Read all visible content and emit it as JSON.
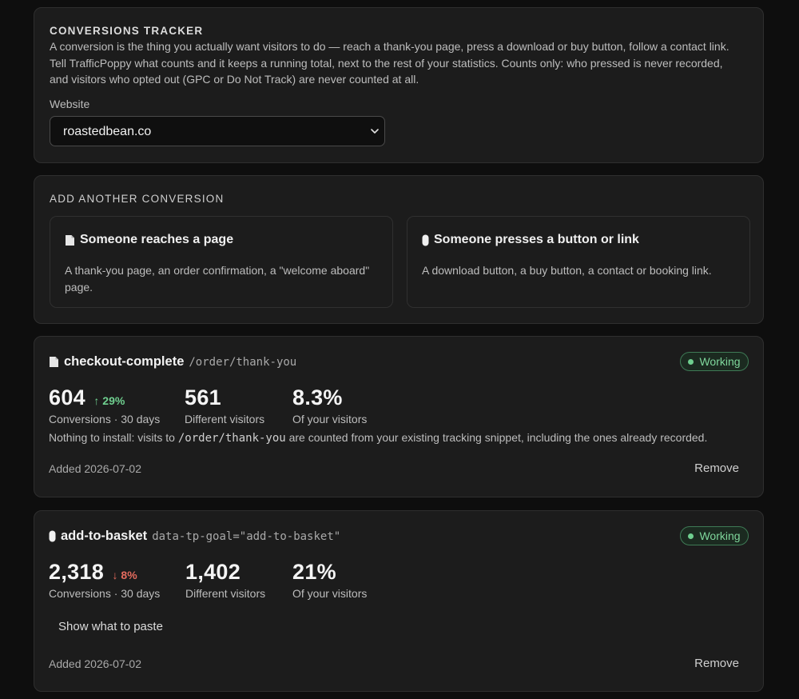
{
  "tracker": {
    "title": "CONVERSIONS TRACKER",
    "description_lines": [
      "A conversion is the thing you actually want visitors to do — reach a thank-you page, press a download or buy button, follow a contact link.",
      "Tell TrafficPoppy what counts and it keeps a running total, next to the rest of your statistics. Counts only: who pressed is never recorded,",
      "and visitors who opted out (GPC or Do Not Track) are never counted at all."
    ],
    "website_label": "Website",
    "website_selected": "roastedbean.co"
  },
  "add": {
    "title": "ADD ANOTHER CONVERSION",
    "options": [
      {
        "icon": "document-icon",
        "title": "Someone reaches a page",
        "desc": "A thank-you page, an order confirmation, a \"welcome aboard\" page."
      },
      {
        "icon": "button-icon",
        "title": "Someone presses a button or link",
        "desc": "A download button, a buy button, a contact or booking link."
      }
    ]
  },
  "goals": [
    {
      "icon": "document-icon",
      "name": "checkout-complete",
      "target": "/order/thank-you",
      "status": "Working",
      "conversions": "604",
      "delta": "29%",
      "delta_dir": "up",
      "conversions_label": "Conversions · 30 days",
      "visitors": "561",
      "visitors_label": "Different visitors",
      "rate": "8.3%",
      "rate_label": "Of your visitors",
      "note_prefix": "Nothing to install: visits to ",
      "note_path": "/order/thank-you",
      "note_suffix": " are counted from your existing tracking snippet, including the ones already recorded.",
      "added": "Added 2026-07-02",
      "remove_label": "Remove"
    },
    {
      "icon": "button-icon",
      "name": "add-to-basket",
      "target": "data-tp-goal=\"add-to-basket\"",
      "status": "Working",
      "conversions": "2,318",
      "delta": "8%",
      "delta_dir": "down",
      "conversions_label": "Conversions · 30 days",
      "visitors": "1,402",
      "visitors_label": "Different visitors",
      "rate": "21%",
      "rate_label": "Of your visitors",
      "show_paste_label": "Show what to paste",
      "added": "Added 2026-07-02",
      "remove_label": "Remove"
    }
  ],
  "colors": {
    "background": "#0e0e0e",
    "card": "#1c1c1c",
    "status_green": "#6fcf8f",
    "delta_down": "#e56b5e"
  }
}
